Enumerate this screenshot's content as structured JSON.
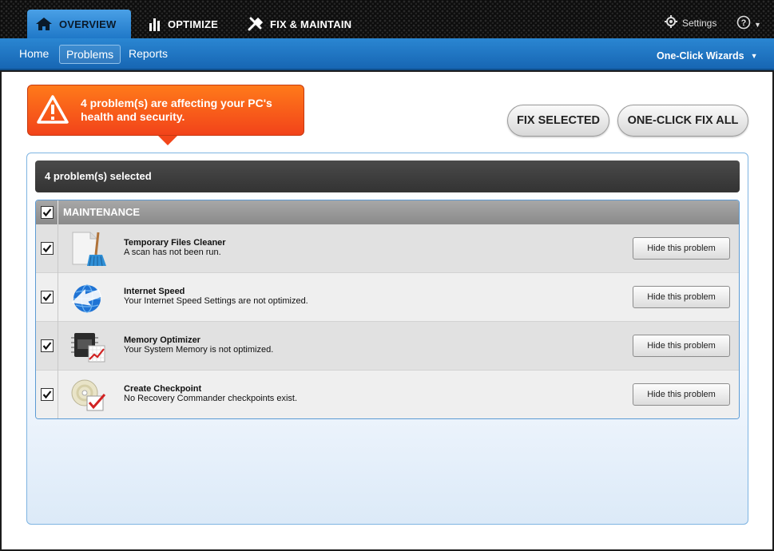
{
  "main_tabs": [
    {
      "label": "OVERVIEW",
      "icon": "house-icon",
      "active": true
    },
    {
      "label": "OPTIMIZE",
      "icon": "bar-chart-icon",
      "active": false
    },
    {
      "label": "FIX & MAINTAIN",
      "icon": "tools-icon",
      "active": false
    }
  ],
  "header": {
    "settings_label": "Settings",
    "help_icon": "help-icon"
  },
  "subnav": {
    "items": [
      {
        "label": "Home",
        "active": false
      },
      {
        "label": "Problems",
        "active": true
      },
      {
        "label": "Reports",
        "active": false
      }
    ],
    "wizards_label": "One-Click Wizards"
  },
  "alert": {
    "text": "4 problem(s) are affecting your PC's health and security.",
    "icon": "warning-icon"
  },
  "actions": {
    "fix_selected": "FIX SELECTED",
    "fix_all": "ONE-CLICK FIX ALL"
  },
  "selected_summary": "4 problem(s) selected",
  "group": {
    "title": "MAINTENANCE",
    "checked": true
  },
  "problems": [
    {
      "title": "Temporary Files Cleaner",
      "description": "A scan has not been run.",
      "icon": "broom-file-icon",
      "checked": true,
      "button": "Hide this problem"
    },
    {
      "title": "Internet Speed",
      "description": "Your Internet Speed Settings are not optimized.",
      "icon": "globe-arrow-icon",
      "checked": true,
      "button": "Hide this problem"
    },
    {
      "title": "Memory Optimizer",
      "description": "Your System Memory is not optimized.",
      "icon": "ram-chip-icon",
      "checked": true,
      "button": "Hide this problem"
    },
    {
      "title": "Create Checkpoint",
      "description": "No Recovery Commander checkpoints exist.",
      "icon": "disc-check-icon",
      "checked": true,
      "button": "Hide this problem"
    }
  ],
  "colors": {
    "accent_blue": "#1f78c8",
    "alert_orange": "#f2431a",
    "dark_bar": "#3a3a3a"
  }
}
